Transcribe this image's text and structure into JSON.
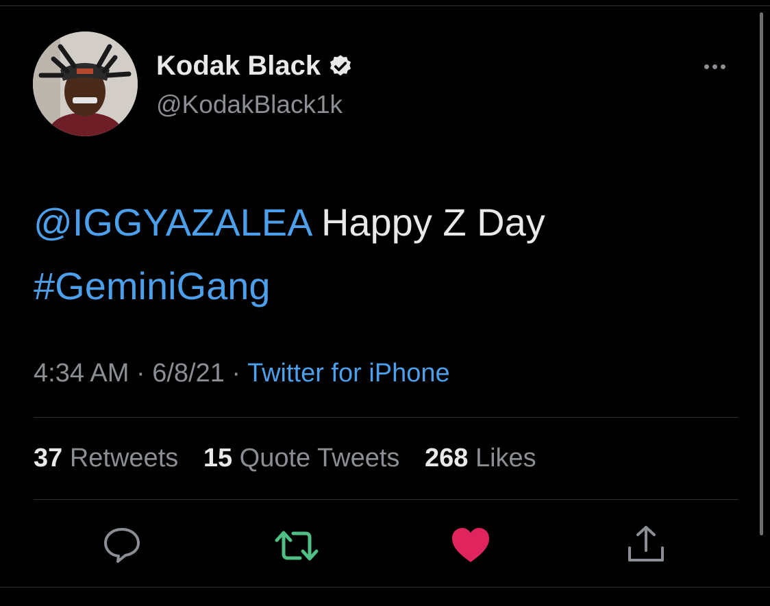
{
  "author": {
    "display_name": "Kodak Black",
    "handle": "@KodakBlack1k",
    "verified": true
  },
  "tweet": {
    "mention": "@IGGYAZALEA",
    "text": " Happy Z Day",
    "hashtag": "#GeminiGang",
    "time": "4:34 AM",
    "separator": " · ",
    "date": "6/8/21",
    "source": "Twitter for iPhone"
  },
  "stats": {
    "retweets": {
      "count": "37",
      "label": "Retweets"
    },
    "quote_tweets": {
      "count": "15",
      "label": "Quote Tweets"
    },
    "likes": {
      "count": "268",
      "label": "Likes"
    }
  },
  "actions": [
    {
      "icon": "reply-icon",
      "color": "#8b8f94"
    },
    {
      "icon": "retweet-icon",
      "color": "#4fbf85"
    },
    {
      "icon": "like-icon",
      "color": "#e0245e"
    },
    {
      "icon": "share-icon",
      "color": "#8b8f94"
    }
  ],
  "colors": {
    "background": "#000000",
    "link": "#4c9fea",
    "liked": "#e0245e",
    "retweeted": "#4fbf85"
  }
}
